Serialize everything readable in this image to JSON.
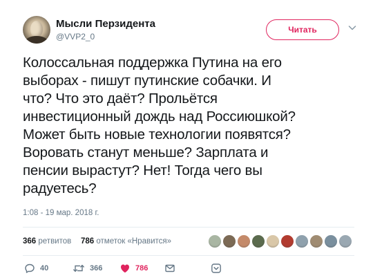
{
  "author": {
    "name": "Мысли Перзидента",
    "handle": "@VVP2_0"
  },
  "follow_button": {
    "label": "Читать"
  },
  "tweet": {
    "lines": [
      "Колоссальная поддержка Путина на его",
      "выборах - пишут путинские собачки. И",
      "что? Что это даёт? Прольётся",
      "инвестиционный дождь над Россиюшкой?",
      "Может быть новые технологии появятся?",
      "Воровать станут меньше? Зарплата и",
      "пенсии вырастут? Нет! Тогда чего вы",
      "радуетесь?"
    ],
    "timestamp": "1:08 - 19 мар. 2018 г."
  },
  "stats": {
    "retweets_count": "366",
    "retweets_label": "ретвитов",
    "likes_count": "786",
    "likes_label": "отметок «Нравится»",
    "liker_avatar_colors": [
      "#a9b6a3",
      "#7c6a55",
      "#c48a6a",
      "#5b6b4e",
      "#d9c7a8",
      "#b23b2f",
      "#8fa1ad",
      "#a08c72",
      "#7a8f9e",
      "#9aa8b2"
    ]
  },
  "actions": {
    "replies": "40",
    "retweets": "366",
    "likes": "786"
  },
  "colors": {
    "accent": "#e0245e",
    "muted": "#657786",
    "text": "#14171a",
    "divider": "#e6ecf0"
  }
}
